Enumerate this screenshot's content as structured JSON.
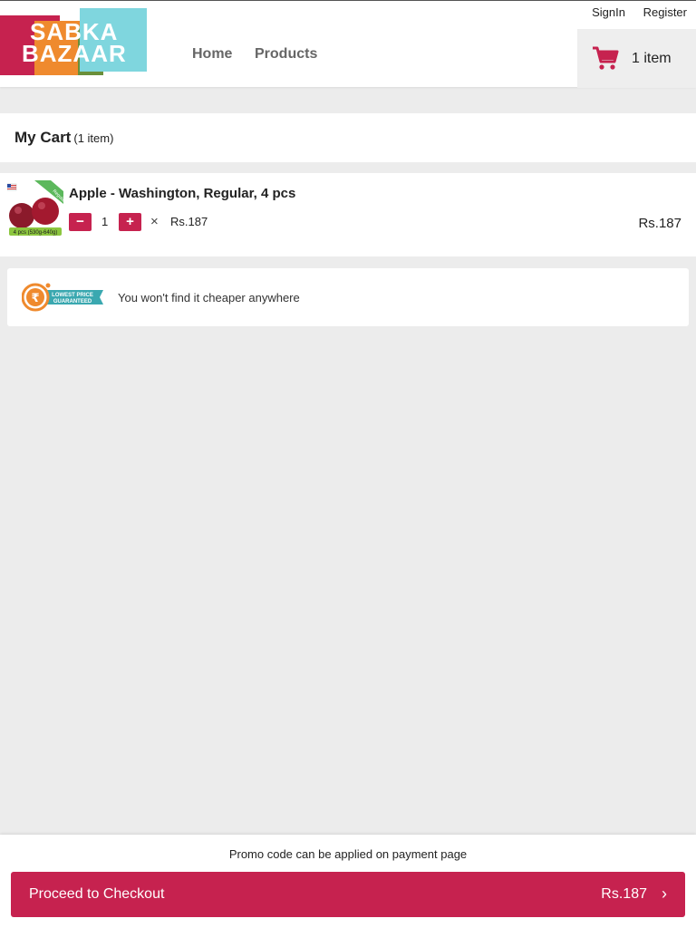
{
  "logo": {
    "line1": "SABKA",
    "line2": "BAZAAR"
  },
  "nav": {
    "home": "Home",
    "products": "Products"
  },
  "auth": {
    "signin": "SignIn",
    "register": "Register"
  },
  "cart_button": {
    "count_label": "1 item",
    "icon": "cart-icon"
  },
  "cart": {
    "title": "My Cart",
    "subtitle": "(1 item)"
  },
  "items": [
    {
      "name": "Apple - Washington, Regular, 4 pcs",
      "quantity": "1",
      "minus": "−",
      "plus": "+",
      "times": "×",
      "unit_price": "Rs.187",
      "total": "Rs.187",
      "image_tag": "4 pcs (530g-640g)",
      "image_ribbon": "Regular"
    }
  ],
  "promo": {
    "badge_line1": "LOWEST PRICE",
    "badge_line2": "GUARANTEED",
    "badge_symbol": "₹",
    "text": "You won't find it cheaper anywhere"
  },
  "footer": {
    "note": "Promo code can be applied on payment page",
    "checkout_label": "Proceed to Checkout",
    "checkout_total": "Rs.187",
    "chevron": "›"
  },
  "colors": {
    "brand": "#c6224f",
    "background": "#ececec",
    "accent_teal": "#7fd6de",
    "accent_orange": "#ef8a2e"
  }
}
